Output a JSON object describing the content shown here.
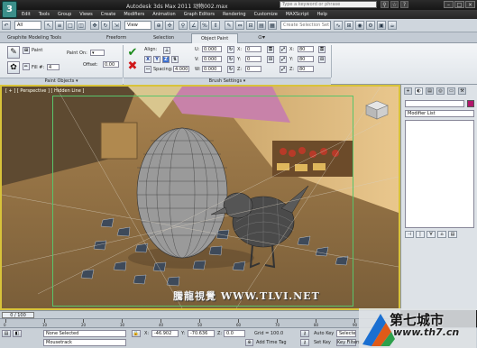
{
  "window": {
    "title": "Autodesk 3ds Max  2011     动物002.max",
    "search_placeholder": "Type a keyword or phrase",
    "app_logo": "3"
  },
  "menu": [
    "Edit",
    "Tools",
    "Group",
    "Views",
    "Create",
    "Modifiers",
    "Animation",
    "Graph Editors",
    "Rendering",
    "Customize",
    "MAXScript",
    "Help"
  ],
  "toolbar": {
    "filter_value": "All",
    "view_value": "View",
    "selection_set_placeholder": "Create Selection Set"
  },
  "ribbon_tabs": [
    "Graphite Modeling Tools",
    "Freeform",
    "Selection",
    "Object Paint"
  ],
  "ribbon_active_tab": "Object Paint",
  "ribbon": {
    "paint_label": "Paint",
    "fill_label": "Fill #:",
    "fill_value": "4",
    "paint_on_label": "Paint On:",
    "offset_label": "Offset:",
    "offset_value": "0.00",
    "palette_footer": "Paint Objects",
    "align_label": "Align:",
    "axes": [
      "X",
      "Y",
      "Z"
    ],
    "spacing_label": "Spacing:",
    "spacing_value": "4.000",
    "u_label": "U:",
    "u_value": "0.000",
    "v_label": "V:",
    "v_value": "0.000",
    "w_label": "W:",
    "w_value": "0.000",
    "x_label": "X:",
    "x_value": "0",
    "y_label": "Y:",
    "y_value": "0",
    "z_label": "Z:",
    "z_value": "0",
    "xs_label": "X:",
    "xs_value": "80",
    "ys_label": "Y:",
    "ys_value": "80",
    "zs_label": "Z:",
    "zs_value": "80",
    "brush_footer": "Brush Settings"
  },
  "viewport": {
    "label": "[ + ] [ Perspective ] [ Hidden Line ]",
    "watermark": "騰龍視覺 WWW.TLVI.NET"
  },
  "command_panel": {
    "tabs": [
      "+",
      "◐",
      "▤",
      "◎",
      "▭",
      "⚒"
    ],
    "modifier_list": "Modifier List",
    "object_color": "#b2166c",
    "stack_tools": [
      "⊣",
      "|",
      "∀",
      "⌂",
      "▤"
    ]
  },
  "timeline": {
    "frame_readout": "0 / 100",
    "ticks": [
      "0",
      "10",
      "20",
      "30",
      "40",
      "50",
      "60",
      "70",
      "80",
      "90",
      "100"
    ]
  },
  "status": {
    "none_selected": "None Selected",
    "mousetrack": "Mousetrack",
    "x_label": "X:",
    "x_value": "-46.902",
    "y_label": "Y:",
    "y_value": "-70.636",
    "z_label": "Z:",
    "z_value": "0.0",
    "grid": "Grid = 100.0",
    "add_time_tag": "Add Time Tag",
    "auto_key": "Auto Key",
    "selected": "Selected",
    "set_key": "Set Key",
    "key_filters": "Key Filters..."
  },
  "brand": {
    "cn": "第七城市",
    "url": "www.th7.cn"
  }
}
